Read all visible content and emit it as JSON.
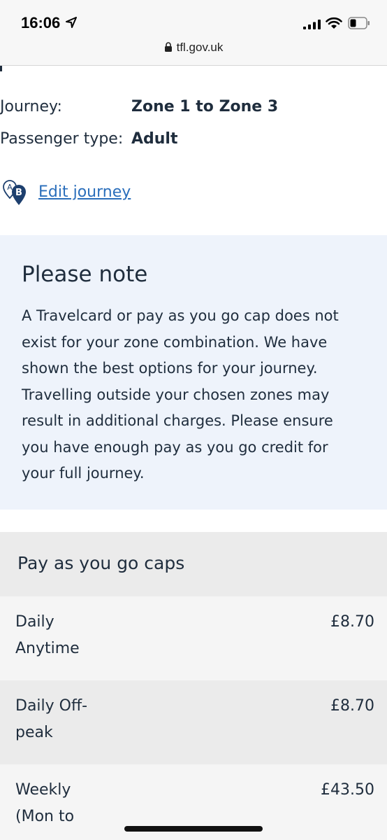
{
  "status_bar": {
    "time": "16:06",
    "url": "tfl.gov.uk",
    "icons": [
      "location-arrow-icon",
      "cellular-signal-icon",
      "wifi-icon",
      "battery-icon",
      "lock-icon"
    ]
  },
  "journey": {
    "journey_label": "Journey:",
    "journey_value": "Zone 1 to Zone 3",
    "passenger_label": "Passenger type:",
    "passenger_value": "Adult",
    "edit_link": "Edit journey",
    "ab_icon_text_a": "A",
    "ab_icon_text_b": "B"
  },
  "note": {
    "title": "Please note",
    "lines": [
      "A Travelcard or pay as you go cap does not",
      "exist for your zone combination. We have",
      "shown the best options for your journey.",
      "Travelling outside your chosen zones may",
      "result in additional charges. Please ensure",
      "you have enough pay as you go credit for",
      "your full journey."
    ]
  },
  "caps": {
    "title": "Pay as you go caps",
    "rows": [
      {
        "name_lines": [
          "Daily",
          "Anytime"
        ],
        "price": "£8.70"
      },
      {
        "name_lines": [
          "Daily Off-",
          "peak"
        ],
        "price": "£8.70"
      },
      {
        "name_lines": [
          "Weekly",
          "(Mon to"
        ],
        "price": "£43.50"
      }
    ]
  },
  "colors": {
    "link": "#2a6ebb",
    "note_background": "#eef3fb",
    "text": "#1f2d3d"
  }
}
